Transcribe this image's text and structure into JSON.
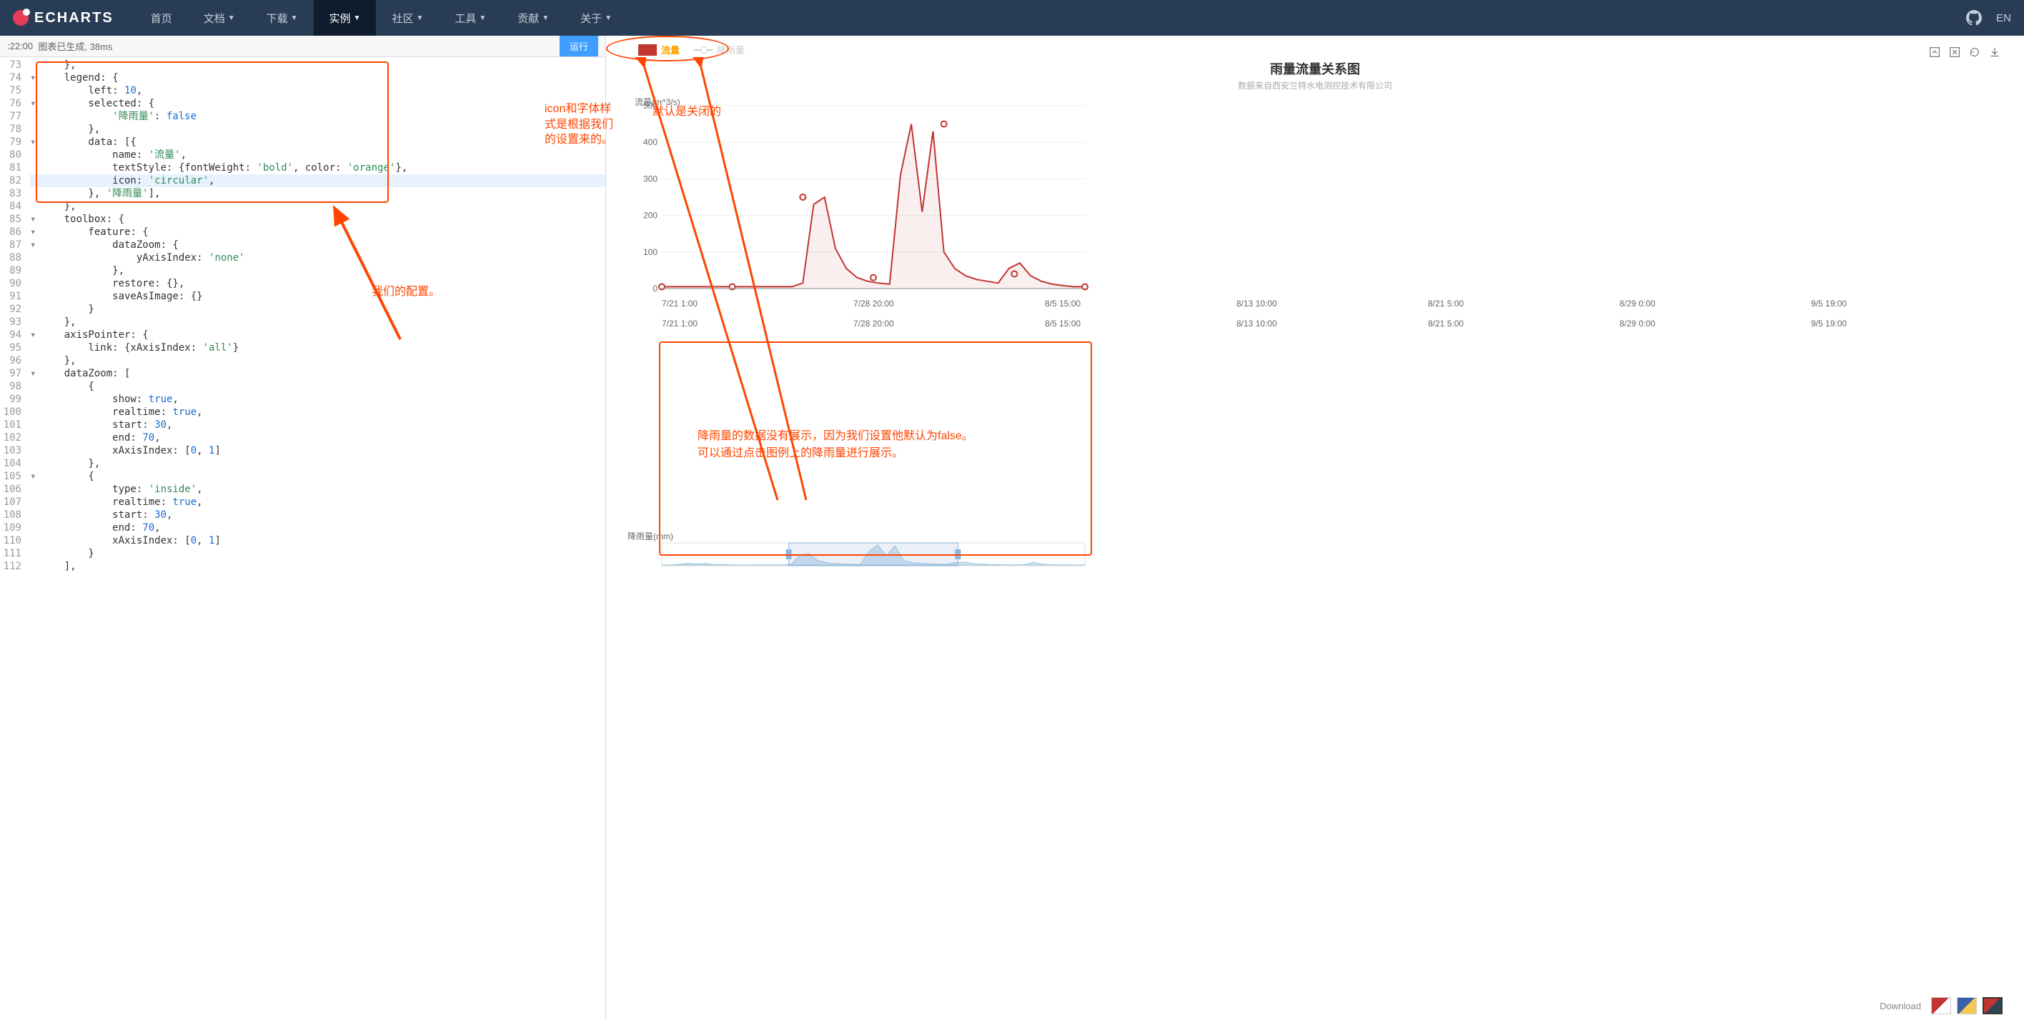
{
  "nav": {
    "brand": "ECHARTS",
    "items": [
      {
        "label": "首页",
        "caret": false
      },
      {
        "label": "文档",
        "caret": true
      },
      {
        "label": "下载",
        "caret": true
      },
      {
        "label": "实例",
        "caret": true,
        "active": true
      },
      {
        "label": "社区",
        "caret": true
      },
      {
        "label": "工具",
        "caret": true
      },
      {
        "label": "贡献",
        "caret": true
      },
      {
        "label": "关于",
        "caret": true
      }
    ],
    "lang": "EN"
  },
  "status": {
    "time": ":22:00",
    "msg": "图表已生成, 38ms",
    "run": "运行"
  },
  "editor": {
    "first_line_no": 73,
    "code_lines": [
      "    },",
      "    legend: {",
      "        left: 10,",
      "        selected: {",
      "            '降雨量': false",
      "        },",
      "        data: [{",
      "            name: '流量',",
      "            textStyle: {fontWeight: 'bold', color: 'orange'},",
      "            icon: 'circular',",
      "        }, '降雨量'],",
      "    },",
      "    toolbox: {",
      "        feature: {",
      "            dataZoom: {",
      "                yAxisIndex: 'none'",
      "            },",
      "            restore: {},",
      "            saveAsImage: {}",
      "        }",
      "    },",
      "    axisPointer: {",
      "        link: {xAxisIndex: 'all'}",
      "    },",
      "    dataZoom: [",
      "        {",
      "            show: true,",
      "            realtime: true,",
      "            start: 30,",
      "            end: 70,",
      "            xAxisIndex: [0, 1]",
      "        },",
      "        {",
      "            type: 'inside',",
      "            realtime: true,",
      "            start: 30,",
      "            end: 70,",
      "            xAxisIndex: [0, 1]",
      "        }",
      "    ],"
    ],
    "highlighted_line": 82,
    "foldable_lines": [
      74,
      76,
      79,
      85,
      86,
      87,
      94,
      97,
      105
    ],
    "red_annotation": "我们的配置。"
  },
  "chart": {
    "legend_flow": "流量",
    "legend_rain": "降雨量",
    "title": "雨量流量关系图",
    "subtitle": "数据来自西安兰特水电测控技术有限公司",
    "y_axis_label": "流量(m^3/s)",
    "rain_axis_label": "降雨量(mm)",
    "download_label": "Download"
  },
  "annotations": {
    "icon_style": "icon和字体样式是根据我们的设置来的。",
    "default_off": "默认是关闭的",
    "rain_hidden": "降雨量的数据没有展示，因为我们设置他默认为false。\n可以通过点击图例上的降雨量进行展示。"
  },
  "chart_data": {
    "type": "line",
    "title": "雨量流量关系图",
    "xlabel": "",
    "ylabel": "流量(m^3/s)",
    "ylim": [
      0,
      500
    ],
    "y_ticks": [
      0,
      100,
      200,
      300,
      400,
      500
    ],
    "categories": [
      "7/21 1:00",
      "7/28 20:00",
      "8/5 15:00",
      "8/13 10:00",
      "8/21 5:00",
      "8/29 0:00",
      "9/5 19:00"
    ],
    "series": [
      {
        "name": "流量",
        "color": "#c23531",
        "values_at_categories": [
          5,
          5,
          250,
          30,
          450,
          40,
          5
        ],
        "dense_values": [
          5,
          5,
          5,
          5,
          5,
          5,
          5,
          5,
          5,
          5,
          5,
          5,
          5,
          15,
          230,
          250,
          110,
          55,
          30,
          20,
          15,
          12,
          310,
          450,
          210,
          430,
          100,
          55,
          35,
          25,
          20,
          15,
          55,
          70,
          35,
          20,
          12,
          8,
          5,
          5
        ]
      },
      {
        "name": "降雨量",
        "color": "#9ec8e0",
        "visible": false,
        "values_at_categories": []
      }
    ],
    "overview_series": {
      "name": "流量 (overview)",
      "values": [
        2,
        3,
        15,
        40,
        20,
        35,
        10,
        15,
        5,
        2,
        2,
        5,
        5,
        5,
        5,
        18,
        230,
        250,
        110,
        55,
        30,
        20,
        15,
        12,
        310,
        450,
        210,
        430,
        100,
        55,
        35,
        25,
        20,
        15,
        55,
        70,
        35,
        20,
        12,
        8,
        5,
        5,
        8,
        60,
        20,
        8,
        5,
        3,
        2,
        2
      ],
      "zoom_window": [
        0.3,
        0.7
      ]
    }
  }
}
